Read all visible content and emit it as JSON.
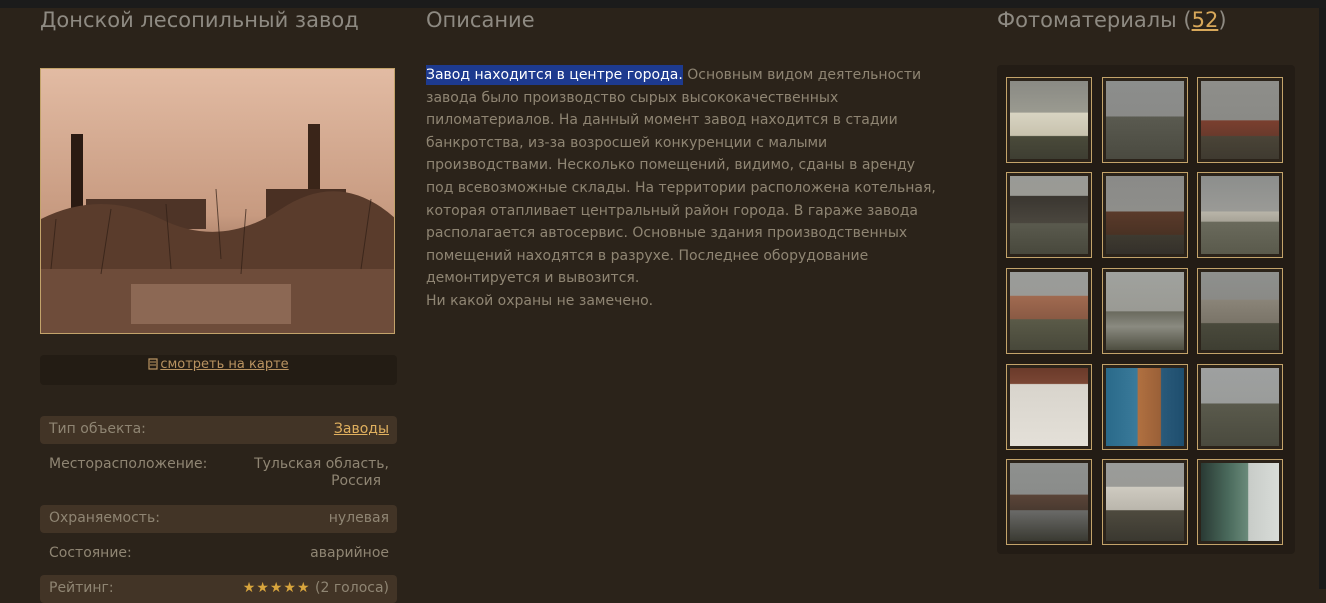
{
  "object": {
    "title": "Донской лесопильный завод",
    "map_link": "смотреть на карте",
    "info": [
      {
        "label": "Тип объекта:",
        "value": "Заводы",
        "link": true
      },
      {
        "label": "Месторасположение:",
        "value_lines": [
          "Тульская область,",
          "Россия"
        ]
      },
      {
        "label": "Охраняемость:",
        "value": "нулевая"
      },
      {
        "label": "Состояние:",
        "value": "аварийное"
      },
      {
        "label": "Рейтинг:",
        "stars": "★★★★★",
        "votes": "(2 голоса)"
      }
    ]
  },
  "description": {
    "title": "Описание",
    "highlighted": "Завод находится в центре города.",
    "text_rest": " Основным видом деятельности завода было производство сырых высококачественных пиломатериалов. На данный момент завод находится в стадии банкротства, из-за возросшей конкуренции с малыми производствами. Несколько помещений, видимо, сданы в аренду под всевозможные склады. На территории расположена котельная, которая отапливает центральный район города. В гараже завода располагается автосервис. Основные здания производственных помещений находятся в разрухе. Последнее оборудование демонтируется и вывозится.",
    "extra": "Ни какой охраны не замечено."
  },
  "photos": {
    "title": "Фотоматериалы (",
    "count": "52",
    "title_end": ")",
    "thumbnails": [
      "building-photo",
      "field-photo",
      "chimney-ruins-photo",
      "barn-photo",
      "brick-ruin-photo",
      "long-barn-photo",
      "trees-building-photo",
      "alley-photo",
      "grey-warehouse-photo",
      "door-interior-photo",
      "blue-room-photo",
      "open-field-photo",
      "water-field-photo",
      "shed-photo",
      "green-interior-photo"
    ]
  },
  "colors": {
    "background": "#2b231a",
    "accent": "#d8a85a",
    "highlight": "#1d3a8f",
    "border": "#c3a36a"
  }
}
